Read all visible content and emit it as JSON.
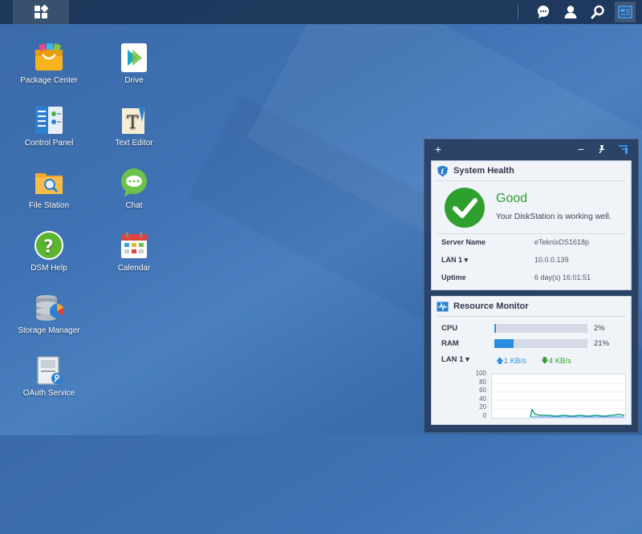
{
  "taskbar": {
    "main_menu_icon": "grid-icon",
    "icons": [
      "chat-bubble-icon",
      "user-icon",
      "search-icon",
      "widgets-icon"
    ]
  },
  "desktop": {
    "icons": [
      {
        "label": "Package Center",
        "icon": "package-center-icon"
      },
      {
        "label": "Drive",
        "icon": "drive-icon"
      },
      {
        "label": "Control Panel",
        "icon": "control-panel-icon"
      },
      {
        "label": "Text Editor",
        "icon": "text-editor-icon"
      },
      {
        "label": "File Station",
        "icon": "file-station-icon"
      },
      {
        "label": "Chat",
        "icon": "chat-icon"
      },
      {
        "label": "DSM Help",
        "icon": "help-icon"
      },
      {
        "label": "Calendar",
        "icon": "calendar-icon"
      },
      {
        "label": "Storage Manager",
        "icon": "storage-manager-icon"
      },
      {
        "label": "OAuth Service",
        "icon": "oauth-service-icon"
      }
    ]
  },
  "widgets": {
    "toolbar": {
      "add": "+",
      "minimize": "−",
      "pin": "pin-icon",
      "manage": "widgets-manage-icon"
    },
    "system_health": {
      "title": "System Health",
      "status": "Good",
      "message": "Your DiskStation is working well.",
      "server_name_label": "Server Name",
      "server_name": "eTeknixDS1618p",
      "lan_label": "LAN 1 ▾",
      "lan_value": "10.0.0.139",
      "uptime_label": "Uptime",
      "uptime_value": "6 day(s) 16:01:51"
    },
    "resource_monitor": {
      "title": "Resource Monitor",
      "cpu_label": "CPU",
      "cpu_pct": "2%",
      "cpu_value": 2,
      "ram_label": "RAM",
      "ram_pct": "21%",
      "ram_value": 21,
      "lan_label": "LAN 1 ▾",
      "upload": "1 KB/s",
      "download": "4 KB/s",
      "chart_yticks": [
        "100",
        "80",
        "60",
        "40",
        "20",
        "0"
      ]
    }
  },
  "colors": {
    "good_green": "#2ea02e",
    "bar_blue": "#2a8de2",
    "upload_blue": "#2a8de2",
    "download_green": "#2ea02e"
  }
}
